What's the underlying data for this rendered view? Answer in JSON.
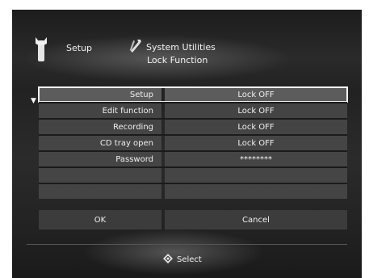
{
  "header": {
    "setup_label": "Setup",
    "utility_label": "System Utilities",
    "subtitle": "Lock Function",
    "setup_icon": "wrench-icon",
    "utility_icon": "tools-icon"
  },
  "rows": [
    {
      "label": "Setup",
      "value": "Lock OFF",
      "selected": true
    },
    {
      "label": "Edit function",
      "value": "Lock OFF"
    },
    {
      "label": "Recording",
      "value": "Lock OFF"
    },
    {
      "label": "CD tray open",
      "value": "Lock OFF"
    },
    {
      "label": "Password",
      "value": "********"
    },
    {
      "label": "",
      "value": ""
    }
  ],
  "buttons": {
    "ok": "OK",
    "cancel": "Cancel"
  },
  "footer": {
    "select_label": "Select",
    "select_icon": "dpad-icon"
  }
}
